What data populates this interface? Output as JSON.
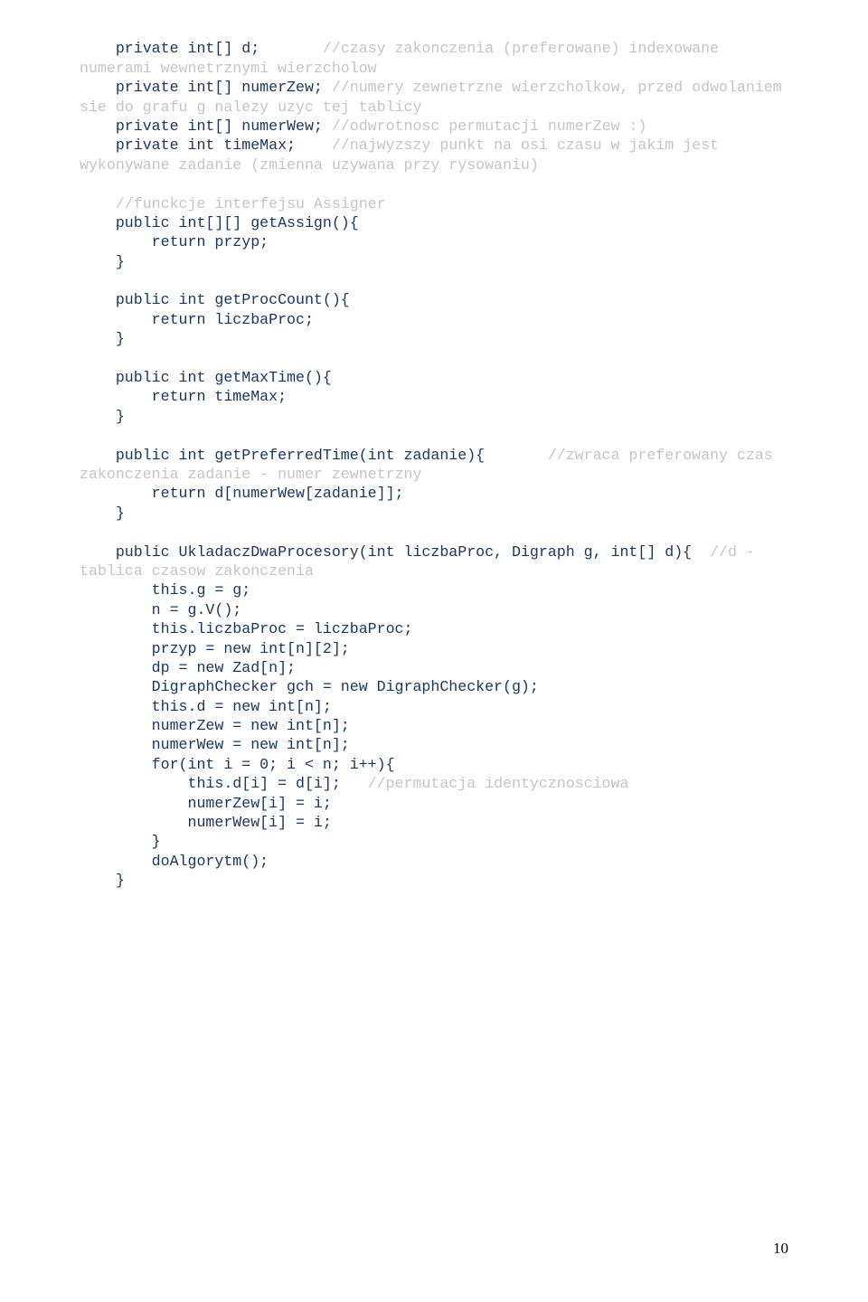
{
  "code": {
    "l01a": "    private int[] d;       ",
    "l01b": "//czasy zakonczenia (preferowane) indexowane",
    "l02": "numerami wewnetrznymi wierzcholow",
    "l03a": "    private int[] numerZew; ",
    "l03b": "//numery zewnetrzne wierzcholkow, przed odwolaniem",
    "l04": "sie do grafu g nalezy uzyc tej tablicy",
    "l05a": "    private int[] numerWew; ",
    "l05b": "//odwrotnosc permutacji numerZew :)",
    "l06a": "    private int timeMax;    ",
    "l06b": "//najwyzszy punkt na osi czasu w jakim jest",
    "l07": "wykonywane zadanie (zmienna uzywana przy rysowaniu)",
    "l08": "",
    "l09": "    //funckcje interfejsu Assigner",
    "l10": "    public int[][] getAssign(){",
    "l11": "        return przyp;",
    "l12": "    }",
    "l13": "",
    "l14": "    public int getProcCount(){",
    "l15": "        return liczbaProc;",
    "l16": "    }",
    "l17": "",
    "l18": "    public int getMaxTime(){",
    "l19": "        return timeMax;",
    "l20": "    }",
    "l21": "",
    "l22a": "    public int getPreferredTime(int zadanie){       ",
    "l22b": "//zwraca preferowany czas",
    "l23": "zakonczenia zadanie - numer zewnetrzny",
    "l24": "        return d[numerWew[zadanie]];",
    "l25": "    }",
    "l26": "",
    "l27a": "    public UkladaczDwaProcesory(int liczbaProc, Digraph g, int[] d){  ",
    "l27b": "//d -",
    "l28": "tablica czasow zakonczenia",
    "l29": "        this.g = g;",
    "l30": "        n = g.V();",
    "l31": "        this.liczbaProc = liczbaProc;",
    "l32": "        przyp = new int[n][2];",
    "l33": "        dp = new Zad[n];",
    "l34": "        DigraphChecker gch = new DigraphChecker(g);",
    "l35": "        this.d = new int[n];",
    "l36": "        numerZew = new int[n];",
    "l37": "        numerWew = new int[n];",
    "l38": "        for(int i = 0; i < n; i++){",
    "l39a": "            this.d[i] = d[i];   ",
    "l39b": "//permutacja identycznosciowa",
    "l40": "            numerZew[i] = i;",
    "l41": "            numerWew[i] = i;",
    "l42": "        }",
    "l43": "        doAlgorytm();",
    "l44": "    }"
  },
  "pageNumber": "10"
}
